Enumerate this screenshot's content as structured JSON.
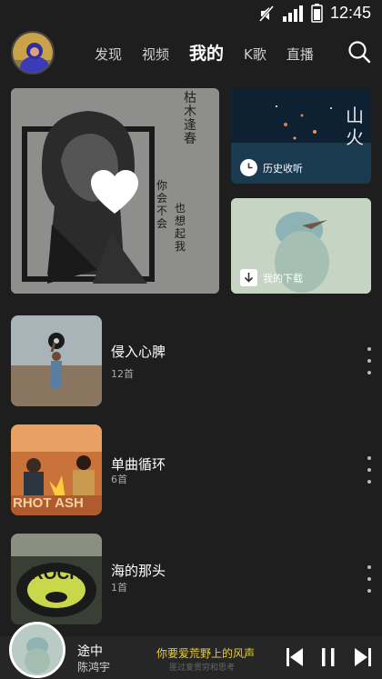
{
  "status": {
    "time": "12:45"
  },
  "nav": {
    "tabs": [
      "发现",
      "视频",
      "我的",
      "K歌",
      "直播"
    ],
    "active_index": 2
  },
  "hero": {
    "cover_text_top": "枯木逢春",
    "cover_text_vertical_1": "你会不会",
    "cover_text_vertical_2": "也想起我"
  },
  "tiles": {
    "history": {
      "label": "历史收听",
      "cover_text": "山火"
    },
    "download": {
      "label": "我的下载"
    }
  },
  "playlists": [
    {
      "title": "侵入心脾",
      "count": "12首"
    },
    {
      "title": "单曲循环",
      "count": "6首"
    },
    {
      "title": "海的那头",
      "count": "1首"
    }
  ],
  "covers": {
    "bonfire_text": "RHOT ASH",
    "rock_text": "ROCK"
  },
  "player": {
    "song": "途中",
    "artist": "陈鸿宇",
    "lyric": "你要爱荒野上的风声",
    "lyric_next": "匪过爱贯穷和思考"
  },
  "colors": {
    "background": "#1e1e1f",
    "lyric": "#e5cf3a"
  }
}
